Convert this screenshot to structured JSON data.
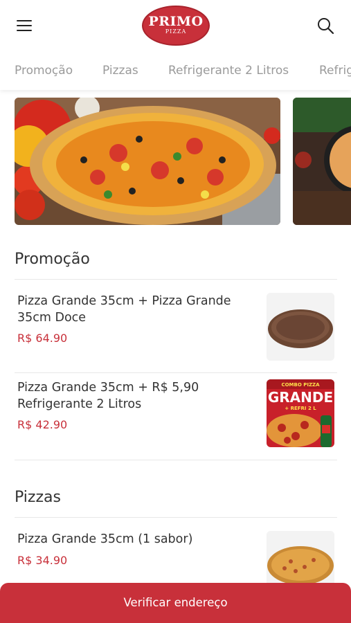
{
  "header": {
    "logo_main": "PRIMO",
    "logo_sub": "PIZZA"
  },
  "category_tabs": [
    {
      "label": "Promoção"
    },
    {
      "label": "Pizzas"
    },
    {
      "label": "Refrigerante 2 Litros"
    },
    {
      "label": "Refrig"
    }
  ],
  "sections": [
    {
      "title": "Promoção",
      "items": [
        {
          "name": "Pizza Grande 35cm + Pizza Grande 35cm Doce",
          "price": "R$ 64.90"
        },
        {
          "name": "Pizza Grande 35cm + R$ 5,90 Refrigerante 2 Litros",
          "price": "R$ 42.90",
          "image_text": {
            "top": "COMBO PIZZA",
            "main": "GRANDE",
            "sub": "+ REFRI 2 L"
          }
        }
      ]
    },
    {
      "title": "Pizzas",
      "items": [
        {
          "name": "Pizza Grande 35cm (1 sabor)",
          "price": "R$ 34.90"
        }
      ]
    }
  ],
  "cta": {
    "label": "Verificar endereço"
  },
  "colors": {
    "brand": "#c8303a",
    "price": "#c8303a",
    "tab_text": "#9a9a9a"
  },
  "icons": [
    "hamburger-menu-icon",
    "search-icon"
  ]
}
